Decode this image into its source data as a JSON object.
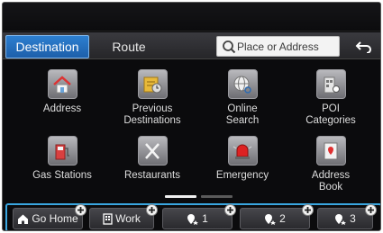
{
  "tabs": {
    "destination": "Destination",
    "route": "Route"
  },
  "search": {
    "placeholder": "Place or Address"
  },
  "grid": [
    {
      "label": "Address",
      "icon": "house-icon"
    },
    {
      "label": "Previous\nDestinations",
      "icon": "previous-destinations-icon"
    },
    {
      "label": "Online\nSearch",
      "icon": "globe-search-icon"
    },
    {
      "label": "POI\nCategories",
      "icon": "poi-building-icon"
    },
    {
      "label": "Gas Stations",
      "icon": "gas-pump-icon"
    },
    {
      "label": "Restaurants",
      "icon": "fork-knife-icon"
    },
    {
      "label": "Emergency",
      "icon": "emergency-light-icon"
    },
    {
      "label": "Address\nBook",
      "icon": "address-book-icon"
    }
  ],
  "favorites": [
    {
      "label": "Go Home",
      "icon": "home-icon"
    },
    {
      "label": "Work",
      "icon": "office-building-icon"
    },
    {
      "label": "1",
      "icon": "favorite-pin-icon"
    },
    {
      "label": "2",
      "icon": "favorite-pin-icon"
    },
    {
      "label": "3",
      "icon": "favorite-pin-icon"
    }
  ],
  "colors": {
    "accent": "#2d7fd0",
    "highlight_border": "#3aa6e0",
    "background": "#0b0b0d"
  }
}
